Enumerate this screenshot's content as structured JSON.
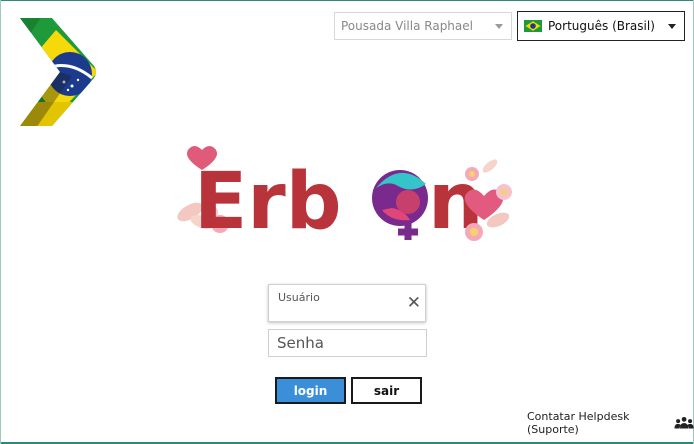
{
  "header": {
    "hotel_select": {
      "value": "Pousada Villa Raphael"
    },
    "language_select": {
      "value": "Português (Brasil)"
    }
  },
  "brand": {
    "logo_text": "Erbon"
  },
  "login": {
    "username_label": "Usuário",
    "username_value": "",
    "password_placeholder": "Senha",
    "login_button": "login",
    "exit_button": "sair"
  },
  "footer": {
    "helpdesk_link": "Contatar Helpdesk (Suporte)"
  },
  "colors": {
    "brand_red": "#b8343a",
    "login_blue": "#3b8fd9",
    "frame_teal": "#2d8a7a",
    "flag_green": "#1f9a3b",
    "flag_yellow": "#f5d90a",
    "flag_blue": "#1c3b8f"
  },
  "icons": [
    "brazil-flag-logo",
    "brazil-flag-icon",
    "chevron-down-icon",
    "clear-icon",
    "people-group-icon"
  ]
}
